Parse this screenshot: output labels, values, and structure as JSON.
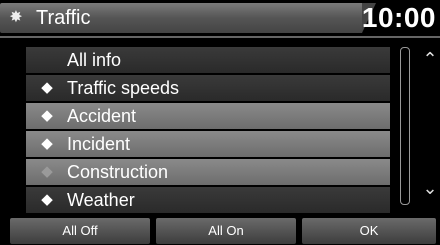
{
  "header": {
    "title": "Traffic",
    "clock": "10:00",
    "icon": "gear-icon"
  },
  "list": [
    {
      "label": "All info",
      "icon": "",
      "selected": false,
      "dim": false
    },
    {
      "label": "Traffic speeds",
      "icon": "◆",
      "selected": false,
      "dim": false
    },
    {
      "label": "Accident",
      "icon": "◆",
      "selected": true,
      "dim": false
    },
    {
      "label": "Incident",
      "icon": "◆",
      "selected": true,
      "dim": false
    },
    {
      "label": "Construction",
      "icon": "◆",
      "selected": true,
      "dim": true
    },
    {
      "label": "Weather",
      "icon": "◆",
      "selected": false,
      "dim": false
    }
  ],
  "scroll": {
    "up_icon": "⌃",
    "down_icon": "⌄"
  },
  "buttons": {
    "all_off": "All Off",
    "all_on": "All On",
    "ok": "OK"
  }
}
